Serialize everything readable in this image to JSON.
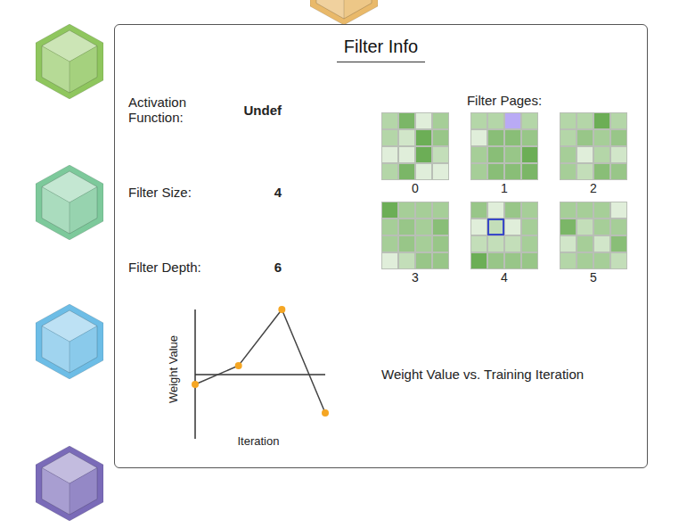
{
  "layers": [
    {
      "color": "#e9b96a"
    },
    {
      "color": "#8fc65e"
    },
    {
      "color": "#7dc99b"
    },
    {
      "color": "#6dbde6"
    },
    {
      "color": "#7a6bb8"
    }
  ],
  "panel": {
    "title": "Filter Info",
    "fields": [
      {
        "label": "Activation Function:",
        "value": "Undef"
      },
      {
        "label": "Filter Size:",
        "value": "4"
      },
      {
        "label": "Filter Depth:",
        "value": "6"
      }
    ],
    "pages_label": "Filter Pages:",
    "pages": [
      {
        "label": "0",
        "cells": [
          {
            "weight": 0.4,
            "selected": false,
            "hovered": false
          },
          {
            "weight": 0.8,
            "selected": false,
            "hovered": false
          },
          {
            "weight": 0.1,
            "selected": false,
            "hovered": false
          },
          {
            "weight": 0.5,
            "selected": false,
            "hovered": false
          },
          {
            "weight": 0.4,
            "selected": false,
            "hovered": false
          },
          {
            "weight": 0.2,
            "selected": false,
            "hovered": false
          },
          {
            "weight": 0.9,
            "selected": false,
            "hovered": false
          },
          {
            "weight": 0.6,
            "selected": false,
            "hovered": false
          },
          {
            "weight": 0.1,
            "selected": false,
            "hovered": false
          },
          {
            "weight": 0.1,
            "selected": false,
            "hovered": false
          },
          {
            "weight": 0.9,
            "selected": false,
            "hovered": false
          },
          {
            "weight": 0.3,
            "selected": false,
            "hovered": false
          },
          {
            "weight": 0.4,
            "selected": false,
            "hovered": false
          },
          {
            "weight": 0.8,
            "selected": false,
            "hovered": false
          },
          {
            "weight": 0.1,
            "selected": false,
            "hovered": false
          },
          {
            "weight": 0.1,
            "selected": false,
            "hovered": false
          }
        ]
      },
      {
        "label": "1",
        "cells": [
          {
            "weight": 0.4,
            "selected": false,
            "hovered": false
          },
          {
            "weight": 0.4,
            "selected": false,
            "hovered": false
          },
          {
            "weight": 0.4,
            "selected": true,
            "hovered": false
          },
          {
            "weight": 0.4,
            "selected": false,
            "hovered": false
          },
          {
            "weight": 0.1,
            "selected": false,
            "hovered": false
          },
          {
            "weight": 0.7,
            "selected": false,
            "hovered": false
          },
          {
            "weight": 0.7,
            "selected": false,
            "hovered": false
          },
          {
            "weight": 0.6,
            "selected": false,
            "hovered": false
          },
          {
            "weight": 0.5,
            "selected": false,
            "hovered": false
          },
          {
            "weight": 0.7,
            "selected": false,
            "hovered": false
          },
          {
            "weight": 0.6,
            "selected": false,
            "hovered": false
          },
          {
            "weight": 0.9,
            "selected": false,
            "hovered": false
          },
          {
            "weight": 0.5,
            "selected": false,
            "hovered": false
          },
          {
            "weight": 0.7,
            "selected": false,
            "hovered": false
          },
          {
            "weight": 0.7,
            "selected": false,
            "hovered": false
          },
          {
            "weight": 0.8,
            "selected": false,
            "hovered": false
          }
        ]
      },
      {
        "label": "2",
        "cells": [
          {
            "weight": 0.4,
            "selected": false,
            "hovered": false
          },
          {
            "weight": 0.4,
            "selected": false,
            "hovered": false
          },
          {
            "weight": 0.9,
            "selected": false,
            "hovered": false
          },
          {
            "weight": 0.4,
            "selected": false,
            "hovered": false
          },
          {
            "weight": 0.4,
            "selected": false,
            "hovered": false
          },
          {
            "weight": 0.6,
            "selected": false,
            "hovered": false
          },
          {
            "weight": 0.5,
            "selected": false,
            "hovered": false
          },
          {
            "weight": 0.6,
            "selected": false,
            "hovered": false
          },
          {
            "weight": 0.5,
            "selected": false,
            "hovered": false
          },
          {
            "weight": 0.1,
            "selected": false,
            "hovered": false
          },
          {
            "weight": 0.4,
            "selected": false,
            "hovered": false
          },
          {
            "weight": 0.2,
            "selected": false,
            "hovered": false
          },
          {
            "weight": 0.5,
            "selected": false,
            "hovered": false
          },
          {
            "weight": 0.3,
            "selected": false,
            "hovered": false
          },
          {
            "weight": 0.7,
            "selected": false,
            "hovered": false
          },
          {
            "weight": 0.6,
            "selected": false,
            "hovered": false
          }
        ]
      },
      {
        "label": "3",
        "cells": [
          {
            "weight": 0.9,
            "selected": false,
            "hovered": false
          },
          {
            "weight": 0.5,
            "selected": false,
            "hovered": false
          },
          {
            "weight": 0.5,
            "selected": false,
            "hovered": false
          },
          {
            "weight": 0.5,
            "selected": false,
            "hovered": false
          },
          {
            "weight": 0.5,
            "selected": false,
            "hovered": false
          },
          {
            "weight": 0.6,
            "selected": false,
            "hovered": false
          },
          {
            "weight": 0.5,
            "selected": false,
            "hovered": false
          },
          {
            "weight": 0.7,
            "selected": false,
            "hovered": false
          },
          {
            "weight": 0.5,
            "selected": false,
            "hovered": false
          },
          {
            "weight": 0.6,
            "selected": false,
            "hovered": false
          },
          {
            "weight": 0.5,
            "selected": false,
            "hovered": false
          },
          {
            "weight": 0.6,
            "selected": false,
            "hovered": false
          },
          {
            "weight": 0.1,
            "selected": false,
            "hovered": false
          },
          {
            "weight": 0.3,
            "selected": false,
            "hovered": false
          },
          {
            "weight": 0.6,
            "selected": false,
            "hovered": false
          },
          {
            "weight": 0.6,
            "selected": false,
            "hovered": false
          }
        ]
      },
      {
        "label": "4",
        "cells": [
          {
            "weight": 0.6,
            "selected": false,
            "hovered": false
          },
          {
            "weight": 0.1,
            "selected": false,
            "hovered": false
          },
          {
            "weight": 0.6,
            "selected": false,
            "hovered": false
          },
          {
            "weight": 0.5,
            "selected": false,
            "hovered": false
          },
          {
            "weight": 0.1,
            "selected": false,
            "hovered": false
          },
          {
            "weight": 0.3,
            "selected": false,
            "hovered": true
          },
          {
            "weight": 0.1,
            "selected": false,
            "hovered": false
          },
          {
            "weight": 0.5,
            "selected": false,
            "hovered": false
          },
          {
            "weight": 0.3,
            "selected": false,
            "hovered": false
          },
          {
            "weight": 0.3,
            "selected": false,
            "hovered": false
          },
          {
            "weight": 0.3,
            "selected": false,
            "hovered": false
          },
          {
            "weight": 0.5,
            "selected": false,
            "hovered": false
          },
          {
            "weight": 0.9,
            "selected": false,
            "hovered": false
          },
          {
            "weight": 0.6,
            "selected": false,
            "hovered": false
          },
          {
            "weight": 0.6,
            "selected": false,
            "hovered": false
          },
          {
            "weight": 0.6,
            "selected": false,
            "hovered": false
          }
        ]
      },
      {
        "label": "5",
        "cells": [
          {
            "weight": 0.5,
            "selected": false,
            "hovered": false
          },
          {
            "weight": 0.5,
            "selected": false,
            "hovered": false
          },
          {
            "weight": 0.5,
            "selected": false,
            "hovered": false
          },
          {
            "weight": 0.1,
            "selected": false,
            "hovered": false
          },
          {
            "weight": 0.8,
            "selected": false,
            "hovered": false
          },
          {
            "weight": 0.3,
            "selected": false,
            "hovered": false
          },
          {
            "weight": 0.5,
            "selected": false,
            "hovered": false
          },
          {
            "weight": 0.5,
            "selected": false,
            "hovered": false
          },
          {
            "weight": 0.2,
            "selected": false,
            "hovered": false
          },
          {
            "weight": 0.5,
            "selected": false,
            "hovered": false
          },
          {
            "weight": 0.2,
            "selected": false,
            "hovered": false
          },
          {
            "weight": 0.7,
            "selected": false,
            "hovered": false
          },
          {
            "weight": 0.4,
            "selected": false,
            "hovered": false
          },
          {
            "weight": 0.5,
            "selected": false,
            "hovered": false
          },
          {
            "weight": 0.5,
            "selected": false,
            "hovered": false
          },
          {
            "weight": 0.3,
            "selected": false,
            "hovered": false
          }
        ]
      }
    ],
    "chart": {
      "y_label": "Weight Value",
      "x_label": "Iteration",
      "caption": "Weight Value vs. Training Iteration",
      "values": [
        -0.11,
        0.1,
        0.73,
        -0.43
      ]
    }
  }
}
